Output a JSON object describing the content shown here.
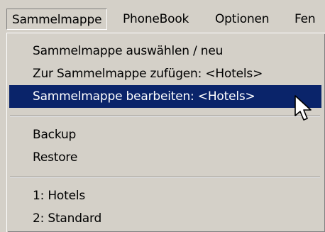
{
  "menubar": {
    "items": [
      {
        "label": "Sammelmappe"
      },
      {
        "label": "PhoneBook"
      },
      {
        "label": "Optionen"
      },
      {
        "label": "Fen"
      }
    ]
  },
  "dropdown": {
    "items": [
      {
        "label": "Sammelmappe auswählen / neu"
      },
      {
        "label": "Zur Sammelmappe zufügen: <Hotels>"
      },
      {
        "label": "Sammelmappe bearbeiten: <Hotels>"
      },
      {
        "label": "Backup"
      },
      {
        "label": "Restore"
      },
      {
        "label": "1: Hotels"
      },
      {
        "label": "2: Standard"
      }
    ]
  },
  "colors": {
    "highlight": "#0a246a",
    "face": "#d4d0c8"
  },
  "cursor": {
    "icon": "arrow-pointer-icon"
  }
}
